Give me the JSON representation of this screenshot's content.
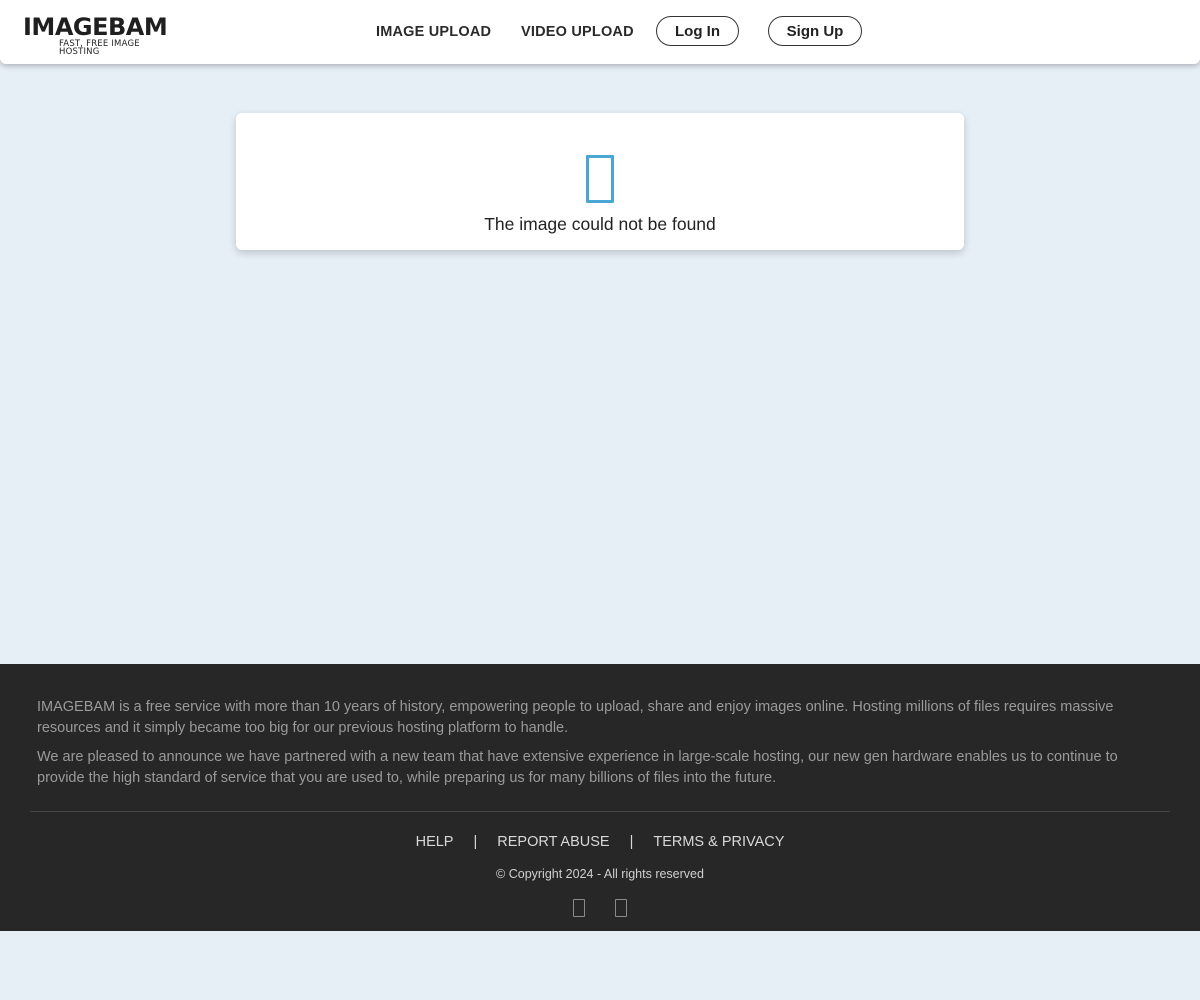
{
  "header": {
    "logo_title": "IMAGEBAM",
    "logo_tagline": "FAST, FREE IMAGE HOSTING",
    "nav": {
      "image_upload": "IMAGE UPLOAD",
      "video_upload": "VIDEO UPLOAD"
    },
    "login_label": "Log In",
    "signup_label": "Sign Up"
  },
  "main": {
    "error_icon": "missing-image-icon",
    "error_message": "The image could not be found",
    "accent_color": "#4aa6d6"
  },
  "footer": {
    "about": [
      "IMAGEBAM is a free service with more than 10 years of history, empowering people to upload, share and enjoy images online. Hosting millions of files requires massive resources and it simply became too big for our previous hosting platform to handle.",
      "We are pleased to announce we have partnered with a new team that have extensive experience in large-scale hosting, our new gen hardware enables us to continue to provide the high standard of service that you are used to, while preparing us for many billions of files into the future."
    ],
    "links": {
      "help": "HELP",
      "report_abuse": "REPORT ABUSE",
      "terms": "TERMS & PRIVACY",
      "separator": "|"
    },
    "copyright": "© Copyright 2024 - All rights reserved",
    "social_icons": [
      "social-icon-1",
      "social-icon-2"
    ]
  },
  "colors": {
    "page_background": "#e6eef6",
    "footer_background": "#272727"
  }
}
